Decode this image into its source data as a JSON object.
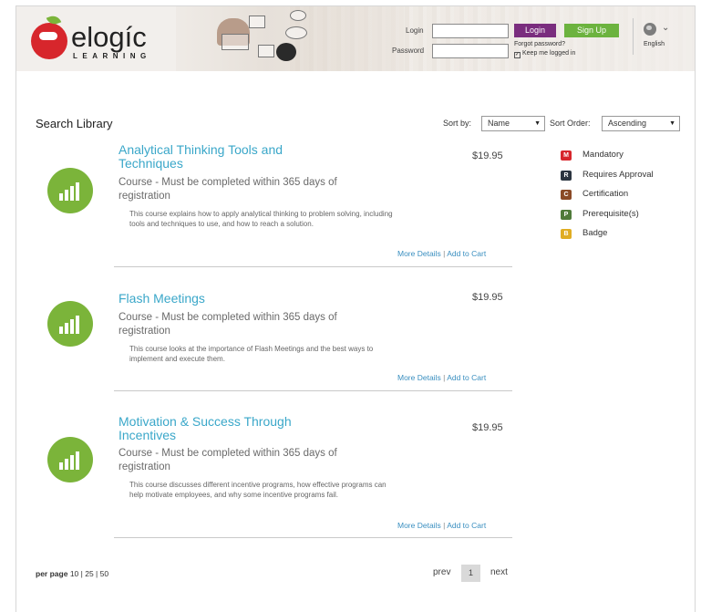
{
  "header": {
    "logo_text": "elogíc",
    "logo_sub": "LEARNING",
    "login_label": "Login",
    "password_label": "Password",
    "login_value": "",
    "password_value": "",
    "login_button": "Login",
    "signup_button": "Sign Up",
    "forgot_password": "Forgot password?",
    "keep_logged_in": "Keep me logged in",
    "language": "English"
  },
  "toolbar": {
    "title": "Search Library",
    "sort_by_label": "Sort by:",
    "sort_by_value": "Name",
    "sort_order_label": "Sort Order:",
    "sort_order_value": "Ascending"
  },
  "courses": [
    {
      "title": "Analytical Thinking Tools and Techniques",
      "price": "$19.95",
      "subtitle": "Course - Must be completed within 365 days of registration",
      "description": "This course explains how to apply analytical thinking to problem solving, including tools and techniques to use, and how to reach a solution.",
      "more_details": "More Details",
      "add_to_cart": "Add to Cart"
    },
    {
      "title": "Flash Meetings",
      "price": "$19.95",
      "subtitle": "Course - Must be completed within 365 days of registration",
      "description": "This course looks at the importance of Flash Meetings and the best ways to implement and execute them.",
      "more_details": "More Details",
      "add_to_cart": "Add to Cart"
    },
    {
      "title": "Motivation & Success Through Incentives",
      "price": "$19.95",
      "subtitle": "Course - Must be completed within 365 days of registration",
      "description": "This course discusses different incentive programs, how effective programs can help motivate employees, and why some incentive programs fail.",
      "more_details": "More Details",
      "add_to_cart": "Add to Cart"
    }
  ],
  "legend": [
    {
      "letter": "M",
      "label": "Mandatory",
      "color": "#d7262c"
    },
    {
      "letter": "R",
      "label": "Requires Approval",
      "color": "#2b3440"
    },
    {
      "letter": "C",
      "label": "Certification",
      "color": "#8a4a26"
    },
    {
      "letter": "P",
      "label": "Prerequisite(s)",
      "color": "#4f7a3a"
    },
    {
      "letter": "B",
      "label": "Badge",
      "color": "#e0ad22"
    }
  ],
  "footer": {
    "per_page_label": "per page",
    "per_page_options": [
      "10",
      "25",
      "50"
    ],
    "prev": "prev",
    "current_page": "1",
    "next": "next"
  },
  "colors": {
    "course_title": "#3aa7c9",
    "course_icon": "#7bb43a",
    "login_button": "#7a2d7e",
    "signup_button": "#6cb33f",
    "link": "#3a8fc0"
  }
}
